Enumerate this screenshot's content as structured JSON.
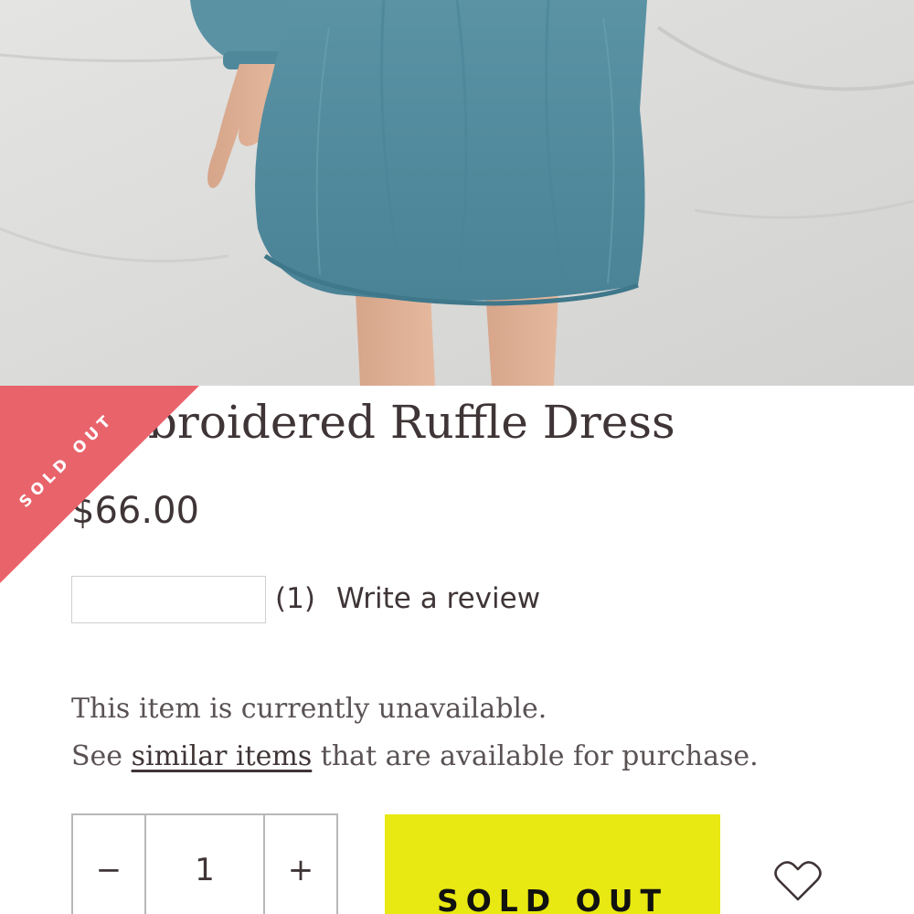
{
  "product": {
    "title": "Embroidered Ruffle Dress",
    "price": "$66.00",
    "badge": "SOLD OUT"
  },
  "reviews": {
    "count": "(1)",
    "write_label": "Write a review"
  },
  "availability": {
    "line1": "This item is currently unavailable.",
    "line2_prefix": "See ",
    "link_text": "similar items",
    "line2_suffix": " that are available for purchase."
  },
  "quantity": {
    "minus": "−",
    "value": "1",
    "plus": "+"
  },
  "buttons": {
    "sold_out": "SOLD OUT"
  },
  "icons": {
    "wishlist": "heart-icon"
  },
  "colors": {
    "badge": "#e9636b",
    "button": "#e8e812",
    "text": "#3f3536"
  }
}
